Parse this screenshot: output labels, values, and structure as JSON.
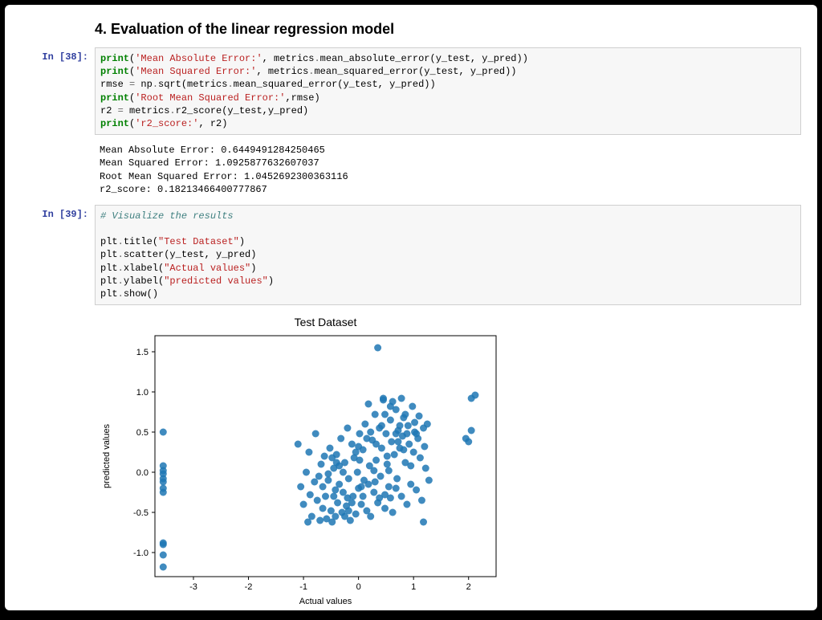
{
  "heading": "4. Evaluation of the linear regression model",
  "cells": [
    {
      "prompt": "In [38]:",
      "code_tokens": [
        {
          "t": "print",
          "c": "k-print"
        },
        {
          "t": "("
        },
        {
          "t": "'Mean Absolute Error:'",
          "c": "k-str"
        },
        {
          "t": ", metrics"
        },
        {
          "t": ".",
          "c": "k-op"
        },
        {
          "t": "mean_absolute_error(y_test, y_pred))\n"
        },
        {
          "t": "print",
          "c": "k-print"
        },
        {
          "t": "("
        },
        {
          "t": "'Mean Squared Error:'",
          "c": "k-str"
        },
        {
          "t": ", metrics"
        },
        {
          "t": ".",
          "c": "k-op"
        },
        {
          "t": "mean_squared_error(y_test, y_pred))\n"
        },
        {
          "t": "rmse "
        },
        {
          "t": "=",
          "c": "k-op"
        },
        {
          "t": " np"
        },
        {
          "t": ".",
          "c": "k-op"
        },
        {
          "t": "sqrt(metrics"
        },
        {
          "t": ".",
          "c": "k-op"
        },
        {
          "t": "mean_squared_error(y_test, y_pred))\n"
        },
        {
          "t": "print",
          "c": "k-print"
        },
        {
          "t": "("
        },
        {
          "t": "'Root Mean Squared Error:'",
          "c": "k-str"
        },
        {
          "t": ",rmse)\n"
        },
        {
          "t": "r2 "
        },
        {
          "t": "=",
          "c": "k-op"
        },
        {
          "t": " metrics"
        },
        {
          "t": ".",
          "c": "k-op"
        },
        {
          "t": "r2_score(y_test,y_pred)\n"
        },
        {
          "t": "print",
          "c": "k-print"
        },
        {
          "t": "("
        },
        {
          "t": "'r2_score:'",
          "c": "k-str"
        },
        {
          "t": ", r2)"
        }
      ],
      "output": "Mean Absolute Error: 0.6449491284250465\nMean Squared Error: 1.0925877632607037\nRoot Mean Squared Error: 1.0452692300363116\nr2_score: 0.18213466400777867"
    },
    {
      "prompt": "In [39]:",
      "code_tokens": [
        {
          "t": "# Visualize the results",
          "c": "k-comment"
        },
        {
          "t": "\n\n"
        },
        {
          "t": "plt"
        },
        {
          "t": ".",
          "c": "k-op"
        },
        {
          "t": "title("
        },
        {
          "t": "\"Test Dataset\"",
          "c": "k-str"
        },
        {
          "t": ")\n"
        },
        {
          "t": "plt"
        },
        {
          "t": ".",
          "c": "k-op"
        },
        {
          "t": "scatter(y_test, y_pred)\n"
        },
        {
          "t": "plt"
        },
        {
          "t": ".",
          "c": "k-op"
        },
        {
          "t": "xlabel("
        },
        {
          "t": "\"Actual values\"",
          "c": "k-str"
        },
        {
          "t": ")\n"
        },
        {
          "t": "plt"
        },
        {
          "t": ".",
          "c": "k-op"
        },
        {
          "t": "ylabel("
        },
        {
          "t": "\"predicted values\"",
          "c": "k-str"
        },
        {
          "t": ")\n"
        },
        {
          "t": "plt"
        },
        {
          "t": ".",
          "c": "k-op"
        },
        {
          "t": "show()"
        }
      ]
    }
  ],
  "chart_data": {
    "type": "scatter",
    "title": "Test Dataset",
    "xlabel": "Actual values",
    "ylabel": "predicted values",
    "xlim": [
      -3.7,
      2.5
    ],
    "ylim": [
      -1.3,
      1.7
    ],
    "xticks": [
      -3,
      -2,
      -1,
      0,
      1,
      2
    ],
    "yticks": [
      -1.0,
      -0.5,
      0.0,
      0.5,
      1.0,
      1.5
    ],
    "points": [
      [
        -3.55,
        -1.18
      ],
      [
        -3.55,
        -1.03
      ],
      [
        -3.55,
        -0.9
      ],
      [
        -3.55,
        -0.88
      ],
      [
        -3.55,
        -0.25
      ],
      [
        -3.55,
        -0.2
      ],
      [
        -3.55,
        -0.12
      ],
      [
        -3.55,
        -0.08
      ],
      [
        -3.55,
        -0.02
      ],
      [
        -3.55,
        0.02
      ],
      [
        -3.55,
        0.08
      ],
      [
        -3.55,
        0.5
      ],
      [
        -1.1,
        0.35
      ],
      [
        -1.05,
        -0.18
      ],
      [
        -1.0,
        -0.4
      ],
      [
        -0.95,
        0.0
      ],
      [
        -0.92,
        -0.62
      ],
      [
        -0.9,
        0.25
      ],
      [
        -0.85,
        -0.55
      ],
      [
        -0.8,
        -0.12
      ],
      [
        -0.78,
        0.48
      ],
      [
        -0.75,
        -0.35
      ],
      [
        -0.7,
        -0.6
      ],
      [
        -0.68,
        0.1
      ],
      [
        -0.65,
        -0.45
      ],
      [
        -0.6,
        -0.3
      ],
      [
        -0.58,
        -0.58
      ],
      [
        -0.55,
        -0.1
      ],
      [
        -0.52,
        0.3
      ],
      [
        -0.5,
        -0.48
      ],
      [
        -0.48,
        -0.62
      ],
      [
        -0.45,
        0.05
      ],
      [
        -0.42,
        -0.55
      ],
      [
        -0.4,
        0.22
      ],
      [
        -0.38,
        -0.38
      ],
      [
        -0.35,
        -0.15
      ],
      [
        -0.32,
        0.42
      ],
      [
        -0.3,
        -0.5
      ],
      [
        -0.28,
        -0.25
      ],
      [
        -0.25,
        0.12
      ],
      [
        -0.22,
        -0.42
      ],
      [
        -0.2,
        0.55
      ],
      [
        -0.18,
        -0.08
      ],
      [
        -0.15,
        -0.6
      ],
      [
        -0.12,
        0.35
      ],
      [
        -0.1,
        -0.3
      ],
      [
        -0.08,
        0.18
      ],
      [
        -0.05,
        -0.52
      ],
      [
        -0.02,
        0.0
      ],
      [
        0.0,
        -0.2
      ],
      [
        0.02,
        0.48
      ],
      [
        0.05,
        -0.4
      ],
      [
        0.08,
        0.28
      ],
      [
        0.1,
        -0.1
      ],
      [
        0.12,
        0.6
      ],
      [
        0.15,
        -0.48
      ],
      [
        0.18,
        0.85
      ],
      [
        0.2,
        0.08
      ],
      [
        0.22,
        -0.55
      ],
      [
        0.25,
        0.4
      ],
      [
        0.28,
        -0.25
      ],
      [
        0.3,
        0.72
      ],
      [
        0.32,
        0.15
      ],
      [
        0.35,
        -0.38
      ],
      [
        0.35,
        1.55
      ],
      [
        0.38,
        0.55
      ],
      [
        0.4,
        -0.05
      ],
      [
        0.42,
        0.3
      ],
      [
        0.45,
        0.9
      ],
      [
        0.48,
        -0.45
      ],
      [
        0.5,
        0.48
      ],
      [
        0.52,
        0.1
      ],
      [
        0.55,
        -0.18
      ],
      [
        0.58,
        0.65
      ],
      [
        0.6,
        0.38
      ],
      [
        0.62,
        -0.5
      ],
      [
        0.65,
        0.22
      ],
      [
        0.68,
        0.78
      ],
      [
        0.7,
        -0.08
      ],
      [
        0.72,
        0.52
      ],
      [
        0.75,
        0.3
      ],
      [
        0.78,
        -0.3
      ],
      [
        0.8,
        0.45
      ],
      [
        0.82,
        0.68
      ],
      [
        0.85,
        0.12
      ],
      [
        0.88,
        -0.4
      ],
      [
        0.9,
        0.58
      ],
      [
        0.92,
        0.35
      ],
      [
        0.95,
        -0.15
      ],
      [
        0.98,
        0.82
      ],
      [
        1.0,
        0.25
      ],
      [
        1.02,
        0.5
      ],
      [
        1.05,
        -0.22
      ],
      [
        1.08,
        0.42
      ],
      [
        1.1,
        0.7
      ],
      [
        1.12,
        0.18
      ],
      [
        1.15,
        -0.35
      ],
      [
        1.18,
        0.55
      ],
      [
        1.2,
        0.32
      ],
      [
        1.22,
        0.05
      ],
      [
        1.25,
        0.6
      ],
      [
        1.28,
        -0.1
      ],
      [
        1.18,
        -0.62
      ],
      [
        0.45,
        0.92
      ],
      [
        0.62,
        0.88
      ],
      [
        1.95,
        0.42
      ],
      [
        2.0,
        0.38
      ],
      [
        2.05,
        0.52
      ],
      [
        2.12,
        0.96
      ],
      [
        2.05,
        0.92
      ],
      [
        -0.55,
        -0.02
      ],
      [
        -0.48,
        0.18
      ],
      [
        -0.35,
        0.08
      ],
      [
        -0.18,
        -0.48
      ],
      [
        -0.05,
        0.25
      ],
      [
        0.08,
        -0.3
      ],
      [
        0.22,
        0.5
      ],
      [
        -0.42,
        -0.22
      ],
      [
        -0.28,
        0.0
      ],
      [
        -0.12,
        -0.38
      ],
      [
        0.02,
        0.15
      ],
      [
        0.18,
        -0.15
      ],
      [
        0.32,
        0.35
      ],
      [
        0.48,
        -0.28
      ],
      [
        0.55,
        0.02
      ],
      [
        0.68,
        -0.2
      ],
      [
        0.82,
        0.28
      ],
      [
        0.95,
        0.08
      ],
      [
        1.05,
        0.48
      ],
      [
        0.38,
        -0.32
      ],
      [
        0.52,
        0.2
      ],
      [
        -0.88,
        -0.28
      ],
      [
        -0.72,
        -0.05
      ],
      [
        -0.62,
        0.2
      ],
      [
        -0.45,
        -0.3
      ],
      [
        0.15,
        0.42
      ],
      [
        0.28,
        0.02
      ],
      [
        -0.2,
        -0.32
      ],
      [
        0.05,
        -0.18
      ],
      [
        0.3,
        -0.12
      ],
      [
        0.58,
        -0.32
      ],
      [
        0.75,
        0.58
      ],
      [
        0.88,
        0.48
      ],
      [
        -0.65,
        -0.18
      ],
      [
        -0.4,
        0.12
      ],
      [
        -0.25,
        -0.55
      ],
      [
        0.0,
        0.32
      ],
      [
        0.42,
        0.58
      ],
      [
        0.72,
        0.38
      ],
      [
        0.48,
        0.72
      ],
      [
        0.68,
        0.48
      ],
      [
        0.85,
        0.72
      ],
      [
        1.02,
        0.62
      ],
      [
        0.58,
        0.82
      ],
      [
        0.78,
        0.92
      ]
    ]
  }
}
